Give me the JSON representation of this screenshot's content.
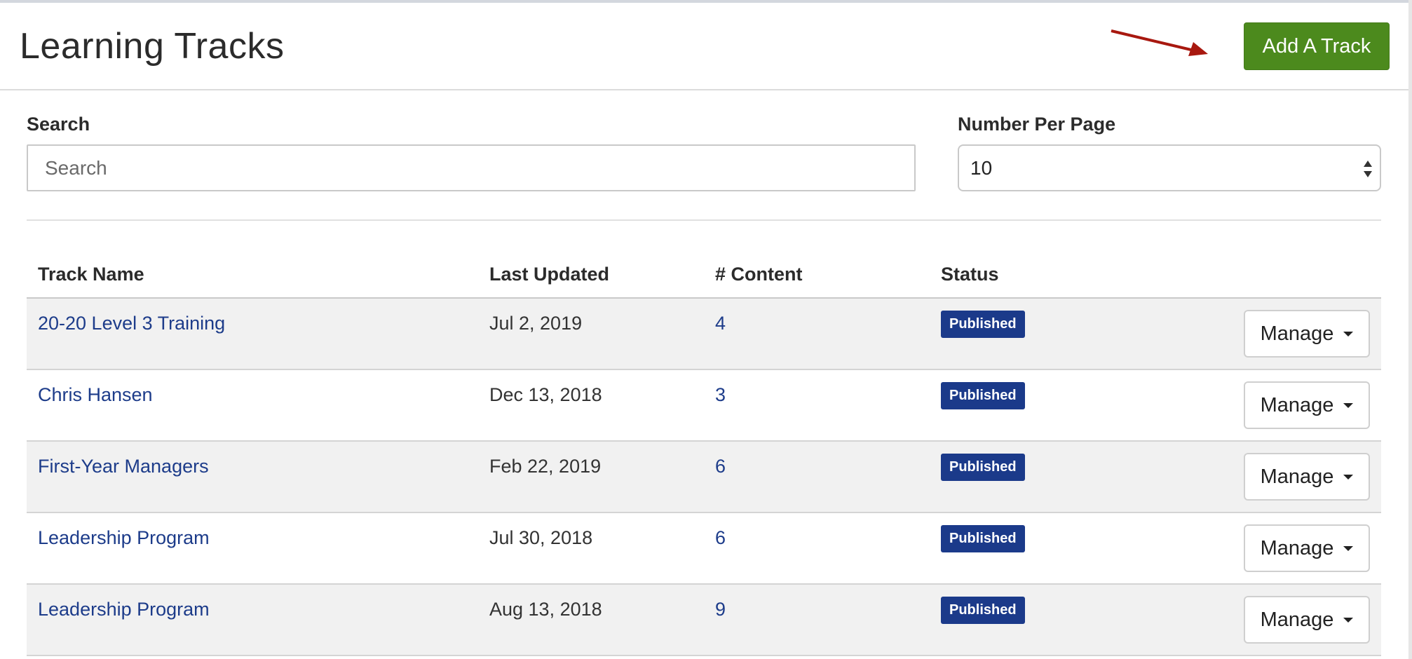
{
  "header": {
    "title": "Learning Tracks",
    "add_button_label": "Add A Track"
  },
  "filters": {
    "search_label": "Search",
    "search_placeholder": "Search",
    "per_page_label": "Number Per Page",
    "per_page_value": "10"
  },
  "table": {
    "columns": [
      "Track Name",
      "Last Updated",
      "# Content",
      "Status"
    ],
    "rows": [
      {
        "name": "20-20 Level 3 Training",
        "updated": "Jul 2, 2019",
        "content": "4",
        "status": "Published",
        "action": "Manage"
      },
      {
        "name": "Chris Hansen",
        "updated": "Dec 13, 2018",
        "content": "3",
        "status": "Published",
        "action": "Manage"
      },
      {
        "name": "First-Year Managers",
        "updated": "Feb 22, 2019",
        "content": "6",
        "status": "Published",
        "action": "Manage"
      },
      {
        "name": "Leadership Program",
        "updated": "Jul 30, 2018",
        "content": "6",
        "status": "Published",
        "action": "Manage"
      },
      {
        "name": "Leadership Program",
        "updated": "Aug 13, 2018",
        "content": "9",
        "status": "Published",
        "action": "Manage"
      }
    ]
  },
  "colors": {
    "primary_button": "#4c8a1d",
    "badge": "#1b3a8a",
    "link": "#1d3c8a",
    "annotation_arrow": "#a8180f"
  },
  "icons": {
    "dropdown": "chevron-down-icon",
    "select_arrows": "sort-arrows-icon",
    "annotation": "arrow-annotation-icon"
  }
}
